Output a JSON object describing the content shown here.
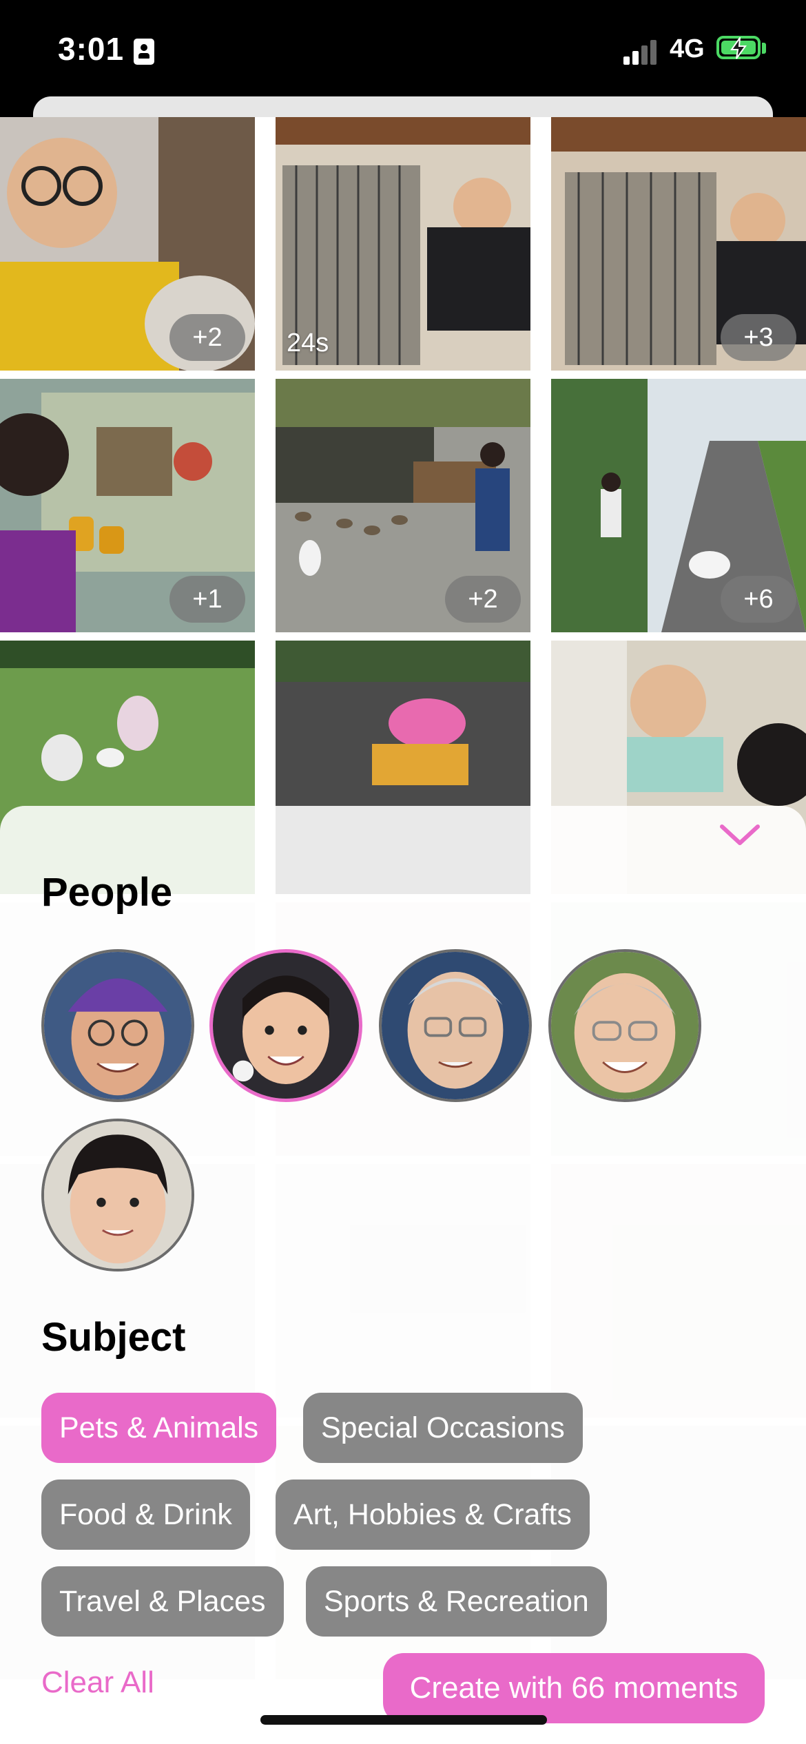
{
  "status_bar": {
    "time": "3:01",
    "network": "4G",
    "battery_color": "#4cd964"
  },
  "grid": {
    "tiles": [
      {
        "badge": "+2"
      },
      {
        "duration": "24s"
      },
      {
        "badge": "+3"
      },
      {
        "badge": "+1"
      },
      {
        "badge": "+2"
      },
      {
        "badge": "+6"
      },
      {},
      {},
      {}
    ]
  },
  "panel": {
    "people_title": "People",
    "people": [
      {
        "name": "man-purple-beanie",
        "selected": false
      },
      {
        "name": "girl-smiling",
        "selected": true
      },
      {
        "name": "older-man-glasses",
        "selected": false
      },
      {
        "name": "older-woman-glasses",
        "selected": false
      },
      {
        "name": "woman-bangs",
        "selected": false
      }
    ],
    "subject_title": "Subject",
    "subjects": [
      {
        "label": "Pets & Animals",
        "active": true
      },
      {
        "label": "Special Occasions",
        "active": false
      },
      {
        "label": "Food & Drink",
        "active": false
      },
      {
        "label": "Art, Hobbies & Crafts",
        "active": false
      },
      {
        "label": "Travel & Places",
        "active": false
      },
      {
        "label": "Sports & Recreation",
        "active": false
      }
    ],
    "clear_all": "Clear All",
    "create_button": "Create with 66 moments",
    "accent_color": "#e96ac9",
    "chip_color": "#878787"
  }
}
